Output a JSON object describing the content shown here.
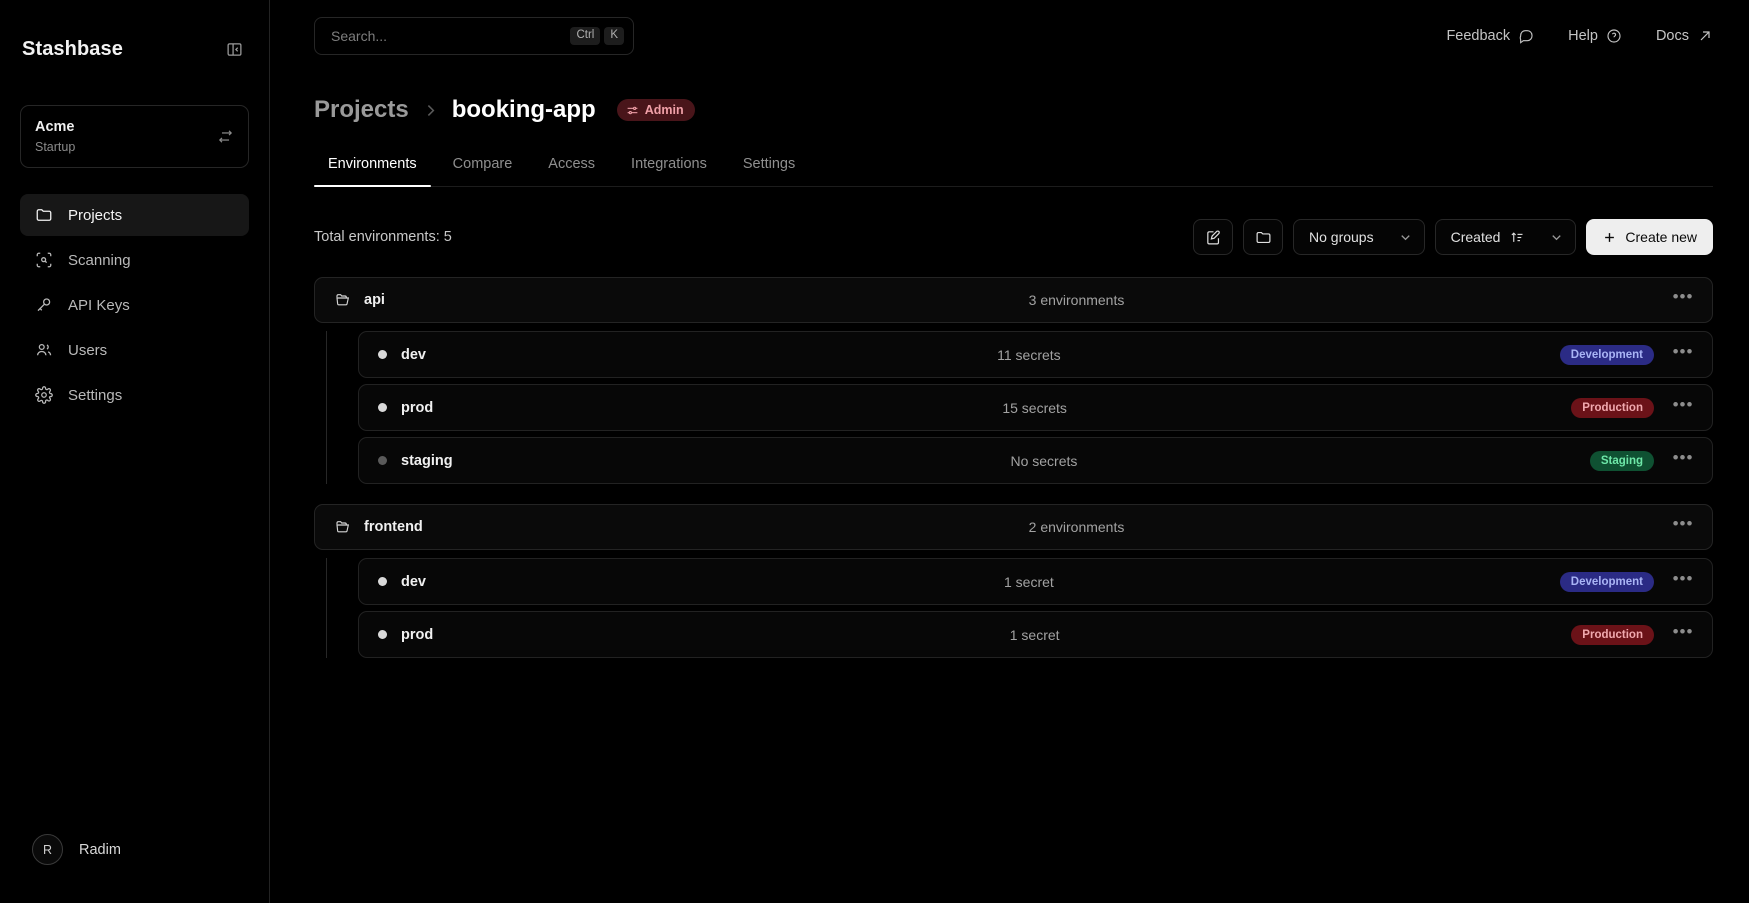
{
  "sidebar": {
    "brand": "Stashbase",
    "collapse_icon": "panel-collapse-icon",
    "org": {
      "name": "Acme",
      "plan": "Startup",
      "switch_icon": "switch-arrows-icon"
    },
    "items": [
      {
        "label": "Projects",
        "icon": "folder-icon",
        "active": true
      },
      {
        "label": "Scanning",
        "icon": "scan-search-icon",
        "active": false
      },
      {
        "label": "API Keys",
        "icon": "key-icon",
        "active": false
      },
      {
        "label": "Users",
        "icon": "users-icon",
        "active": false
      },
      {
        "label": "Settings",
        "icon": "gear-icon",
        "active": false
      }
    ],
    "user": {
      "initial": "R",
      "name": "Radim"
    }
  },
  "topbar": {
    "search": {
      "placeholder": "Search...",
      "keys": [
        "Ctrl",
        "K"
      ],
      "value": ""
    },
    "links": [
      {
        "label": "Feedback",
        "icon": "message-icon"
      },
      {
        "label": "Help",
        "icon": "question-circle-icon"
      },
      {
        "label": "Docs",
        "icon": "external-link-icon"
      }
    ]
  },
  "breadcrumb": {
    "parent": "Projects",
    "separator": "chevron-right-icon",
    "current": "booking-app",
    "badge": {
      "label": "Admin",
      "icon": "sliders-icon",
      "bg": "#49151a",
      "fg": "#f0a0a8"
    }
  },
  "tabs": [
    {
      "label": "Environments",
      "active": true
    },
    {
      "label": "Compare",
      "active": false
    },
    {
      "label": "Access",
      "active": false
    },
    {
      "label": "Integrations",
      "active": false
    },
    {
      "label": "Settings",
      "active": false
    }
  ],
  "toolbar": {
    "total_text": "Total environments: 5",
    "edit_icon": "edit-note-icon",
    "folder_icon": "folder-icon",
    "group_select": {
      "label": "No groups",
      "chevron": "chevron-down-icon"
    },
    "sort_select": {
      "label": "Created",
      "sort_icon": "sort-asc-icon",
      "chevron": "chevron-down-icon"
    },
    "create_button": {
      "label": "Create new",
      "plus": "plus-icon"
    }
  },
  "groups": [
    {
      "name": "api",
      "icon": "folder-open-icon",
      "count_text": "3 environments",
      "menu": "more-options-icon",
      "environments": [
        {
          "name": "dev",
          "secrets_text": "11 secrets",
          "dot": "#d9d9d9",
          "badge": {
            "label": "Development",
            "bg": "#2b2b85",
            "fg": "#a9b4f5"
          },
          "menu": "more-options-icon"
        },
        {
          "name": "prod",
          "secrets_text": "15 secrets",
          "dot": "#d9d9d9",
          "badge": {
            "label": "Production",
            "bg": "#6b1218",
            "fg": "#f0a8ae"
          },
          "menu": "more-options-icon"
        },
        {
          "name": "staging",
          "secrets_text": "No secrets",
          "dot": "#5a5a5a",
          "badge": {
            "label": "Staging",
            "bg": "#0f5132",
            "fg": "#6ee7a8"
          },
          "menu": "more-options-icon"
        }
      ]
    },
    {
      "name": "frontend",
      "icon": "folder-open-icon",
      "count_text": "2 environments",
      "menu": "more-options-icon",
      "environments": [
        {
          "name": "dev",
          "secrets_text": "1 secret",
          "dot": "#d9d9d9",
          "badge": {
            "label": "Development",
            "bg": "#2b2b85",
            "fg": "#a9b4f5"
          },
          "menu": "more-options-icon"
        },
        {
          "name": "prod",
          "secrets_text": "1 secret",
          "dot": "#d9d9d9",
          "badge": {
            "label": "Production",
            "bg": "#6b1218",
            "fg": "#f0a8ae"
          },
          "menu": "more-options-icon"
        }
      ]
    }
  ]
}
